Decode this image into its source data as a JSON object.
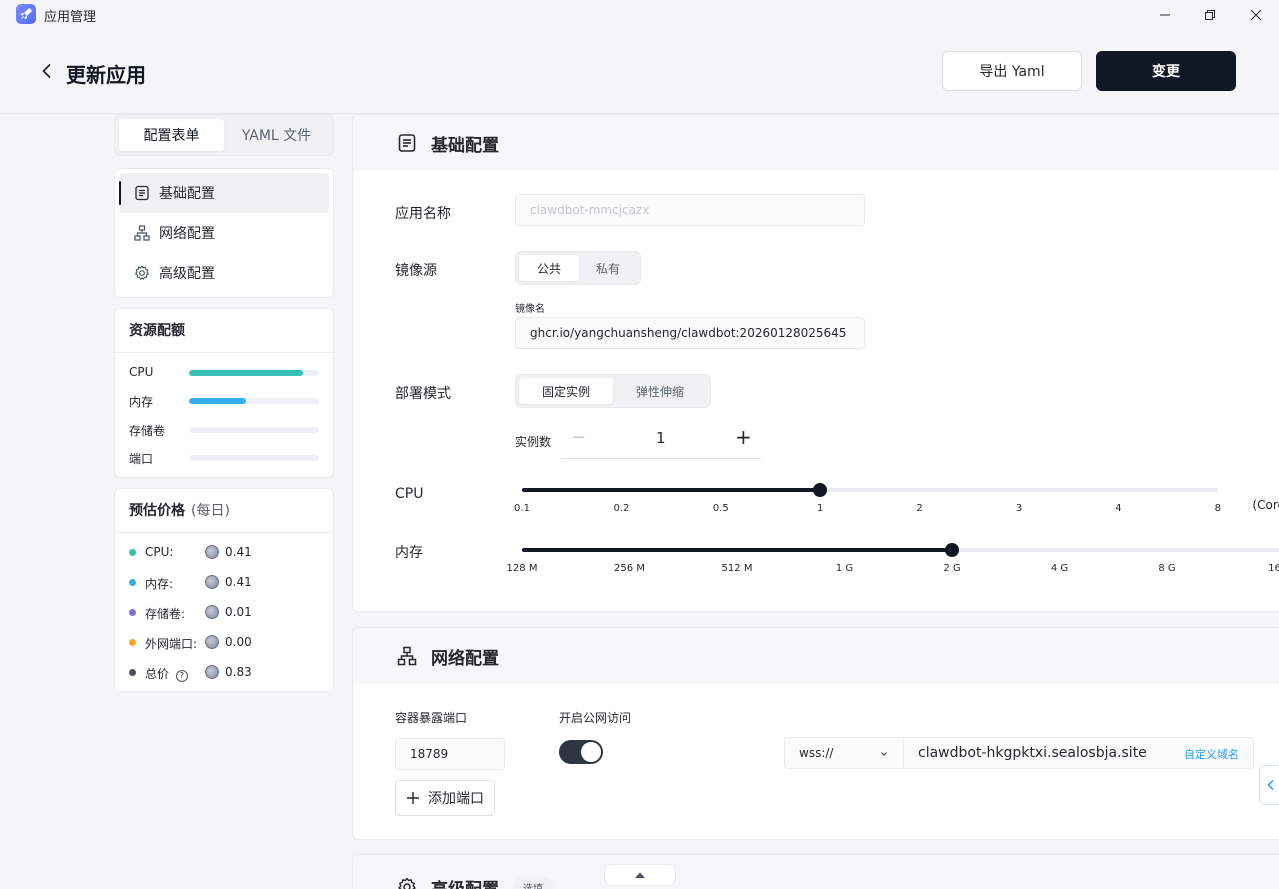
{
  "window": {
    "title": "应用管理"
  },
  "header": {
    "title": "更新应用",
    "export_label": "导出 Yaml",
    "change_label": "变更"
  },
  "tabs": [
    {
      "label": "配置表单"
    },
    {
      "label": "YAML 文件"
    }
  ],
  "nav": [
    {
      "label": "基础配置",
      "icon": "document-icon"
    },
    {
      "label": "网络配置",
      "icon": "network-icon"
    },
    {
      "label": "高级配置",
      "icon": "gear-icon"
    }
  ],
  "resources": {
    "title": "资源配额",
    "items": [
      {
        "label": "CPU",
        "fraction": 0.88,
        "color": "#36bfb6"
      },
      {
        "label": "内存",
        "fraction": 0.44,
        "color": "#36adef"
      },
      {
        "label": "存储卷",
        "fraction": 0,
        "color": "#8172d8"
      },
      {
        "label": "端口",
        "fraction": 0,
        "color": "#f5a623"
      }
    ]
  },
  "price": {
    "title": "预估价格",
    "subtitle": "(每日)",
    "items": [
      {
        "label": "CPU:",
        "value": "0.41",
        "color": "#36bfb6"
      },
      {
        "label": "内存:",
        "value": "0.41",
        "color": "#36adef"
      },
      {
        "label": "存储卷:",
        "value": "0.01",
        "color": "#8172d8"
      },
      {
        "label": "外网端口:",
        "value": "0.00",
        "color": "#f5a623"
      },
      {
        "label": "总价",
        "value": "0.83",
        "color": "#485264",
        "help": "?"
      }
    ]
  },
  "basic": {
    "title": "基础配置",
    "app_name_label": "应用名称",
    "app_name_placeholder": "clawdbot-mmcjcazx",
    "image_source_label": "镜像源",
    "image_source_options": [
      "公共",
      "私有"
    ],
    "image_name_label": "镜像名",
    "image_name_value": "ghcr.io/yangchuansheng/clawdbot:20260128025645",
    "deploy_mode_label": "部署模式",
    "deploy_mode_options": [
      "固定实例",
      "弹性伸缩"
    ],
    "instances_label": "实例数",
    "instances_value": "1",
    "minus": "−",
    "plus": "+",
    "cpu_label": "CPU",
    "cpu_ticks": [
      "0.1",
      "0.2",
      "0.5",
      "1",
      "2",
      "3",
      "4",
      "8"
    ],
    "cpu_unit": "(Core)",
    "cpu_value": "1",
    "memory_label": "内存",
    "memory_ticks": [
      "128 M",
      "256 M",
      "512 M",
      "1 G",
      "2 G",
      "4 G",
      "8 G",
      "16"
    ],
    "memory_value": "2 G"
  },
  "network": {
    "title": "网络配置",
    "port_label": "容器暴露端口",
    "port_value": "18789",
    "public_label": "开启公网访问",
    "public_enabled": true,
    "protocol_value": "wss://",
    "domain_value": "clawdbot-hkgpktxi.sealosbja.site",
    "custom_domain_label": "自定义域名",
    "add_port_label": "添加端口"
  },
  "advanced": {
    "title": "高级配置",
    "badge": "选填"
  }
}
